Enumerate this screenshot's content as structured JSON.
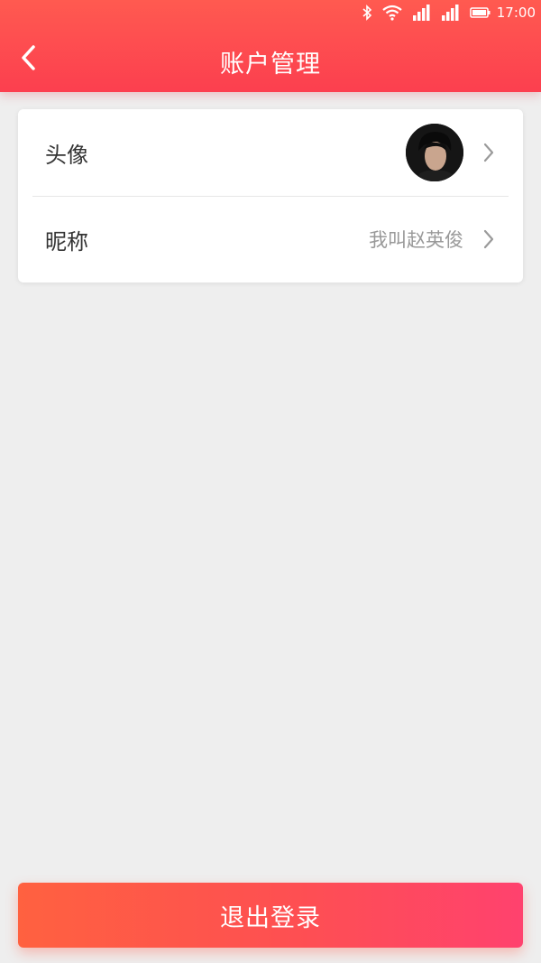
{
  "status_bar": {
    "time": "17:00",
    "icons": [
      "bluetooth-icon",
      "wifi-icon",
      "signal-icon",
      "signal-icon",
      "battery-icon"
    ]
  },
  "header": {
    "title": "账户管理",
    "back_icon": "chevron-left-icon",
    "background_colors": [
      "#ff5a50",
      "#fc3f4f"
    ]
  },
  "account": {
    "items": [
      {
        "label": "头像",
        "value": "",
        "type": "avatar",
        "icon": "chevron-right-icon"
      },
      {
        "label": "昵称",
        "value": "我叫赵英俊",
        "type": "text",
        "icon": "chevron-right-icon"
      }
    ]
  },
  "logout": {
    "label": "退出登录",
    "colors": [
      "#ff6140",
      "#ff426e"
    ]
  }
}
